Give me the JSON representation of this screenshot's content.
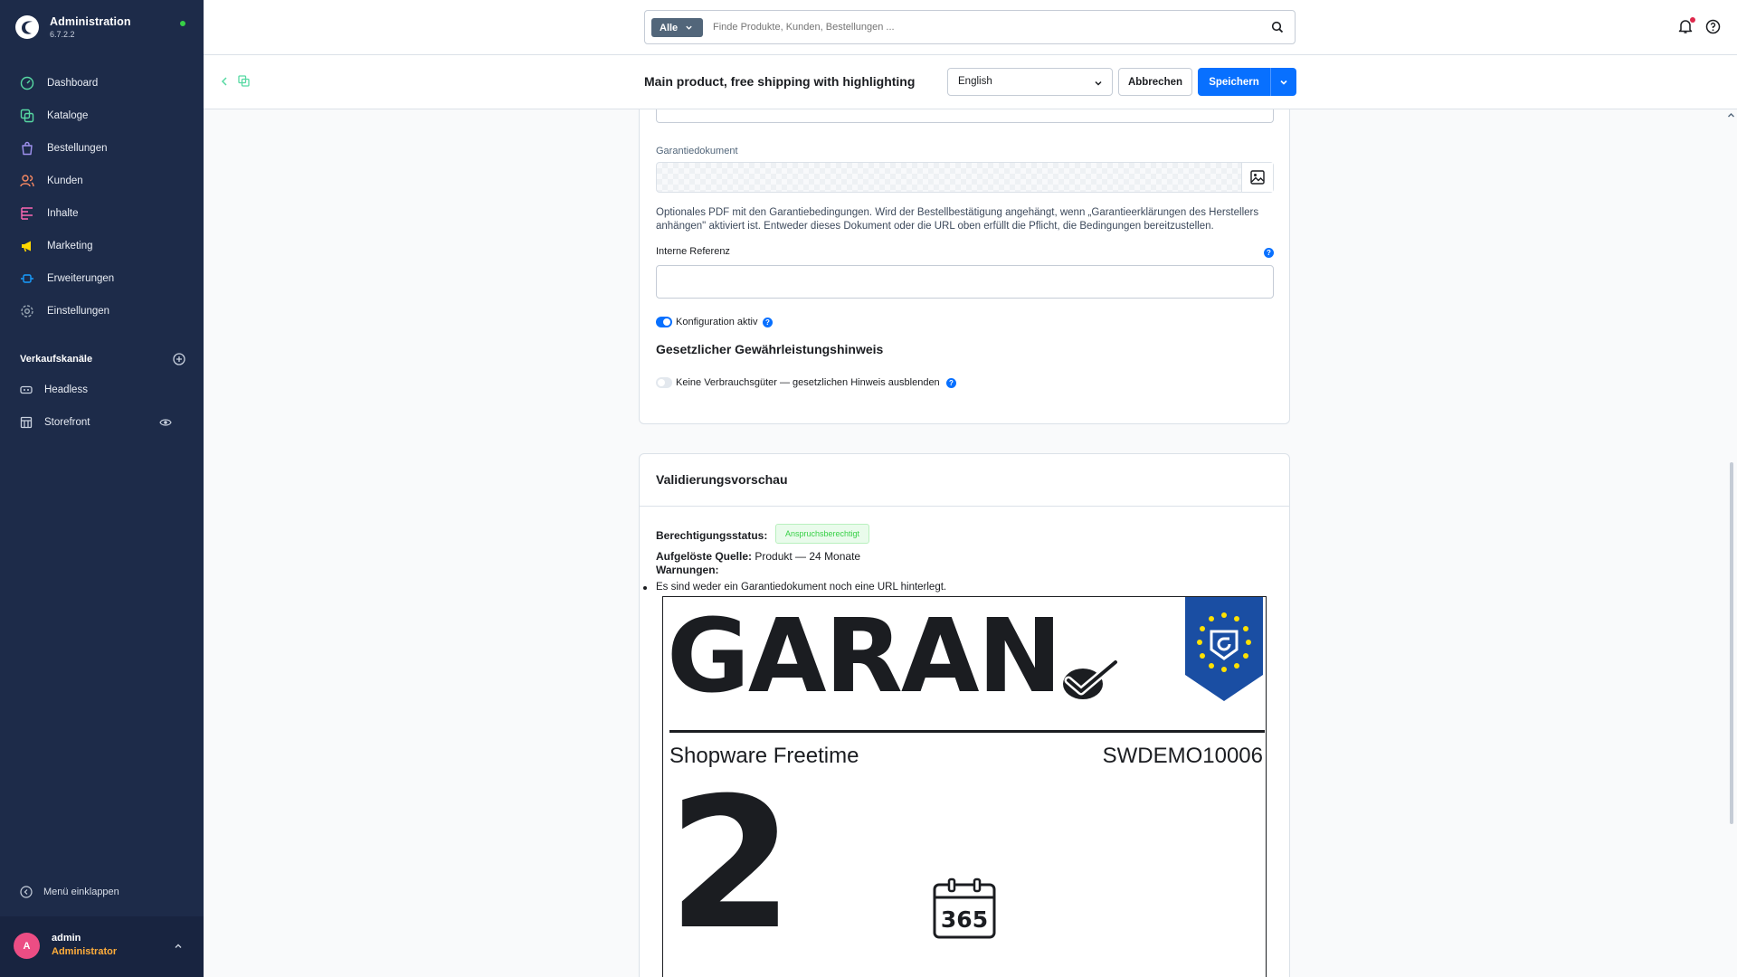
{
  "app": {
    "title": "Administration",
    "version": "6.7.2.2"
  },
  "sidebar": {
    "items": [
      {
        "label": "Dashboard",
        "icon": "dashboard-icon",
        "color": "#57d9a3"
      },
      {
        "label": "Kataloge",
        "icon": "catalog-icon",
        "color": "#57d9a3"
      },
      {
        "label": "Bestellungen",
        "icon": "orders-icon",
        "color": "#a092f0"
      },
      {
        "label": "Kunden",
        "icon": "customers-icon",
        "color": "#f88962"
      },
      {
        "label": "Inhalte",
        "icon": "content-icon",
        "color": "#ff68b4"
      },
      {
        "label": "Marketing",
        "icon": "marketing-icon",
        "color": "#ffd700"
      },
      {
        "label": "Erweiterungen",
        "icon": "extensions-icon",
        "color": "#189eff"
      },
      {
        "label": "Einstellungen",
        "icon": "settings-icon",
        "color": "#9aa8b5"
      }
    ],
    "sales_channels_heading": "Verkaufskanäle",
    "sales_channels": [
      {
        "label": "Headless",
        "icon": "headless-icon"
      },
      {
        "label": "Storefront",
        "icon": "storefront-icon"
      }
    ],
    "collapse_label": "Menü einklappen",
    "user": {
      "initial": "A",
      "name": "admin",
      "role": "Administrator"
    }
  },
  "search": {
    "type_label": "Alle",
    "placeholder": "Finde Produkte, Kunden, Bestellungen ..."
  },
  "smartbar": {
    "title": "Main product, free shipping with highlighting",
    "language": "English",
    "cancel_label": "Abbrechen",
    "save_label": "Speichern"
  },
  "form": {
    "warranty_document_label": "Garantiedokument",
    "warranty_document_help": "Optionales PDF mit den Garantiebedingungen. Wird der Bestellbestätigung angehängt, wenn „Garantieerklärungen des Herstellers anhängen\" aktiviert ist. Entweder dieses Dokument oder die URL oben erfüllt die Pflicht, die Bedingungen bereitzustellen.",
    "internal_reference_label": "Interne Referenz",
    "internal_reference_value": "",
    "config_active_label": "Konfiguration aktiv",
    "config_active": true,
    "legal_heading": "Gesetzlicher Gewährleistungshinweis",
    "no_consumer_goods_label": "Keine Verbrauchsgüter — gesetzlichen Hinweis ausblenden",
    "no_consumer_goods": false
  },
  "validation": {
    "title": "Validierungsvorschau",
    "eligibility_label": "Berechtigungsstatus:",
    "eligibility_badge": "Anspruchsberechtigt",
    "resolved_source_label": "Aufgelöste Quelle:",
    "resolved_source_value": "Produkt — 24 Monate",
    "warnings_label": "Warnungen:",
    "warnings": [
      "Es sind weder ein Garantiedokument noch eine URL hinterlegt."
    ],
    "preview": {
      "headline": "GARAN",
      "product_name": "Shopware Freetime",
      "product_number": "SWDEMO10006",
      "years": "2",
      "calendar_days": "365"
    }
  },
  "colors": {
    "sidebar_bg": "#1d2b49",
    "primary": "#0870ff",
    "success": "#37d046",
    "avatar": "#ec4d84",
    "role": "#ffad3b",
    "eu_blue": "#1a4ea3",
    "eu_star": "#ffe100"
  }
}
